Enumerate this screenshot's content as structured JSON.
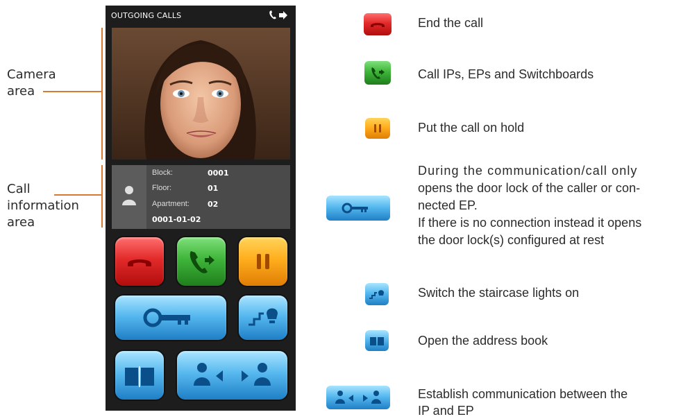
{
  "annotations": {
    "camera_area": [
      "Camera",
      "area"
    ],
    "call_info_area": [
      "Call",
      "information",
      "area"
    ]
  },
  "screen": {
    "title": "OUTGOING CALLS",
    "header_icon": "outgoing-call-icon"
  },
  "call_info": {
    "block_label": "Block:",
    "block_value": "0001",
    "floor_label": "Floor:",
    "floor_value": "01",
    "apartment_label": "Apartment:",
    "apartment_value": "02",
    "full_code": "0001-01-02"
  },
  "buttons": [
    {
      "name": "end-call",
      "icon": "hangup-icon",
      "color": "#e22a2a"
    },
    {
      "name": "call",
      "icon": "call-icon",
      "color": "#3fb53a"
    },
    {
      "name": "hold",
      "icon": "pause-icon",
      "color": "#ffae1e"
    },
    {
      "name": "door-lock",
      "icon": "key-icon",
      "color": "#57b9ef"
    },
    {
      "name": "staircase-lights",
      "icon": "stairs-light-icon",
      "color": "#57b9ef"
    },
    {
      "name": "address-book",
      "icon": "book-icon",
      "color": "#57b9ef"
    },
    {
      "name": "connect-ip-ep",
      "icon": "persons-connect-icon",
      "color": "#57b9ef"
    }
  ],
  "legend": {
    "end_call": "End the call",
    "call": "Call IPs, EPs and Switchboards",
    "hold": "Put the call on hold",
    "door_lock": [
      "During the communication/call only",
      "opens the door lock of the caller or con-",
      "nected EP.",
      "If there is no connection instead it opens",
      "the door lock(s) configured at rest"
    ],
    "staircase": "Switch the staircase lights on",
    "address_book": "Open the address book",
    "connect": [
      "Establish communication between the",
      "IP and EP"
    ]
  }
}
